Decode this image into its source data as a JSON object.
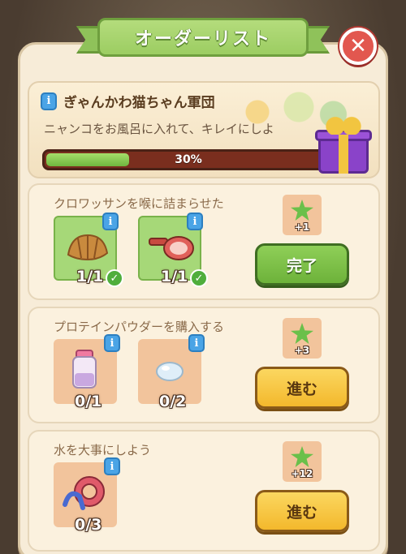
{
  "window": {
    "title": "オーダーリスト",
    "close_symbol": "✕"
  },
  "header": {
    "title": "ぎゃんかわ猫ちゃん軍団",
    "description": "ニャンコをお風呂に入れて、キレイにしよ",
    "progress": 0.3,
    "progress_label": "30%",
    "gift_icon": "gift-box-icon"
  },
  "info_symbol": "i",
  "tasks": [
    {
      "name": "クロワッサンを喉に詰まらせた",
      "items": [
        {
          "icon": "croissant-icon",
          "count": "1/1",
          "done": true
        },
        {
          "icon": "frying-pan-icon",
          "count": "1/1",
          "done": true
        }
      ],
      "reward": "+1",
      "button": "完了",
      "button_style": "green"
    },
    {
      "name": "プロテインパウダーを購入する",
      "items": [
        {
          "icon": "shaker-bottle-icon",
          "count": "0/1",
          "done": false
        },
        {
          "icon": "powder-drop-icon",
          "count": "0/2",
          "done": false
        }
      ],
      "reward": "+3",
      "button": "進む",
      "button_style": "yellow"
    },
    {
      "name": "水を大事にしよう",
      "items": [
        {
          "icon": "water-hose-icon",
          "count": "0/3",
          "done": false
        }
      ],
      "reward": "+12",
      "button": "進む",
      "button_style": "yellow"
    }
  ],
  "colors": {
    "accent_green": "#8fcf58",
    "button_yellow": "#f3b82c",
    "progress_track": "#7a2e1e",
    "close_red": "#e2574f"
  }
}
